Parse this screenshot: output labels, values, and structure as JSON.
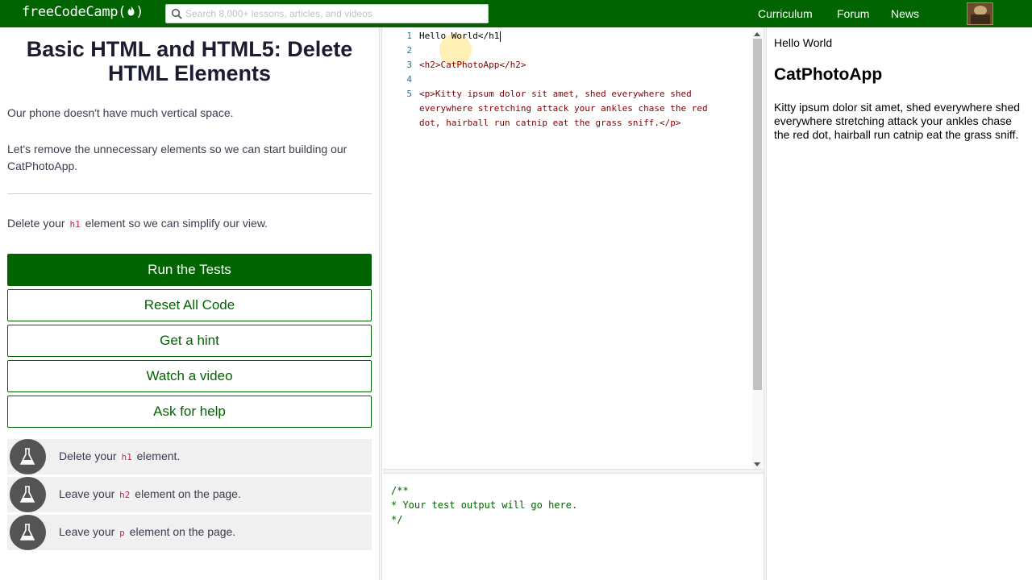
{
  "nav": {
    "logo": "freeCodeCamp(",
    "logo_end": ")",
    "search_placeholder": "Search 8,000+ lessons, articles, and videos",
    "links": [
      "Curriculum",
      "Forum",
      "News"
    ]
  },
  "challenge": {
    "title": "Basic HTML and HTML5: Delete HTML Elements",
    "desc1": "Our phone doesn't have much vertical space.",
    "desc2": "Let's remove the unnecessary elements so we can start building our CatPhotoApp.",
    "instr_pre": "Delete your ",
    "instr_code": "h1",
    "instr_post": " element so we can simplify our view."
  },
  "buttons": {
    "run": "Run the Tests",
    "reset": "Reset All Code",
    "hint": "Get a hint",
    "video": "Watch a video",
    "help": "Ask for help"
  },
  "tests": [
    {
      "pre": "Delete your ",
      "code": "h1",
      "post": " element."
    },
    {
      "pre": "Leave your ",
      "code": "h2",
      "post": " element on the page."
    },
    {
      "pre": "Leave your ",
      "code": "p",
      "post": " element on the page."
    }
  ],
  "editor": {
    "line_numbers": [
      "1",
      "2",
      "3",
      "4",
      "5"
    ],
    "line1": "Hello World</h1",
    "line3": "<h2>CatPhotoApp</h2>",
    "line5a": "<p>Kitty ipsum dolor sit amet, shed everywhere shed",
    "line5b": "everywhere stretching attack your ankles chase the red",
    "line5c": "dot, hairball run catnip eat the grass sniff.</p>"
  },
  "output": {
    "l1": "/**",
    "l2": "* Your test output will go here.",
    "l3": "*/"
  },
  "preview": {
    "h1": "Hello World",
    "h2": "CatPhotoApp",
    "p": "Kitty ipsum dolor sit amet, shed everywhere shed everywhere stretching attack your ankles chase the red dot, hairball run catnip eat the grass sniff."
  },
  "colors": {
    "brand_green": "#006400",
    "dark_text": "#1b1b32",
    "test_badge": "#545454"
  }
}
